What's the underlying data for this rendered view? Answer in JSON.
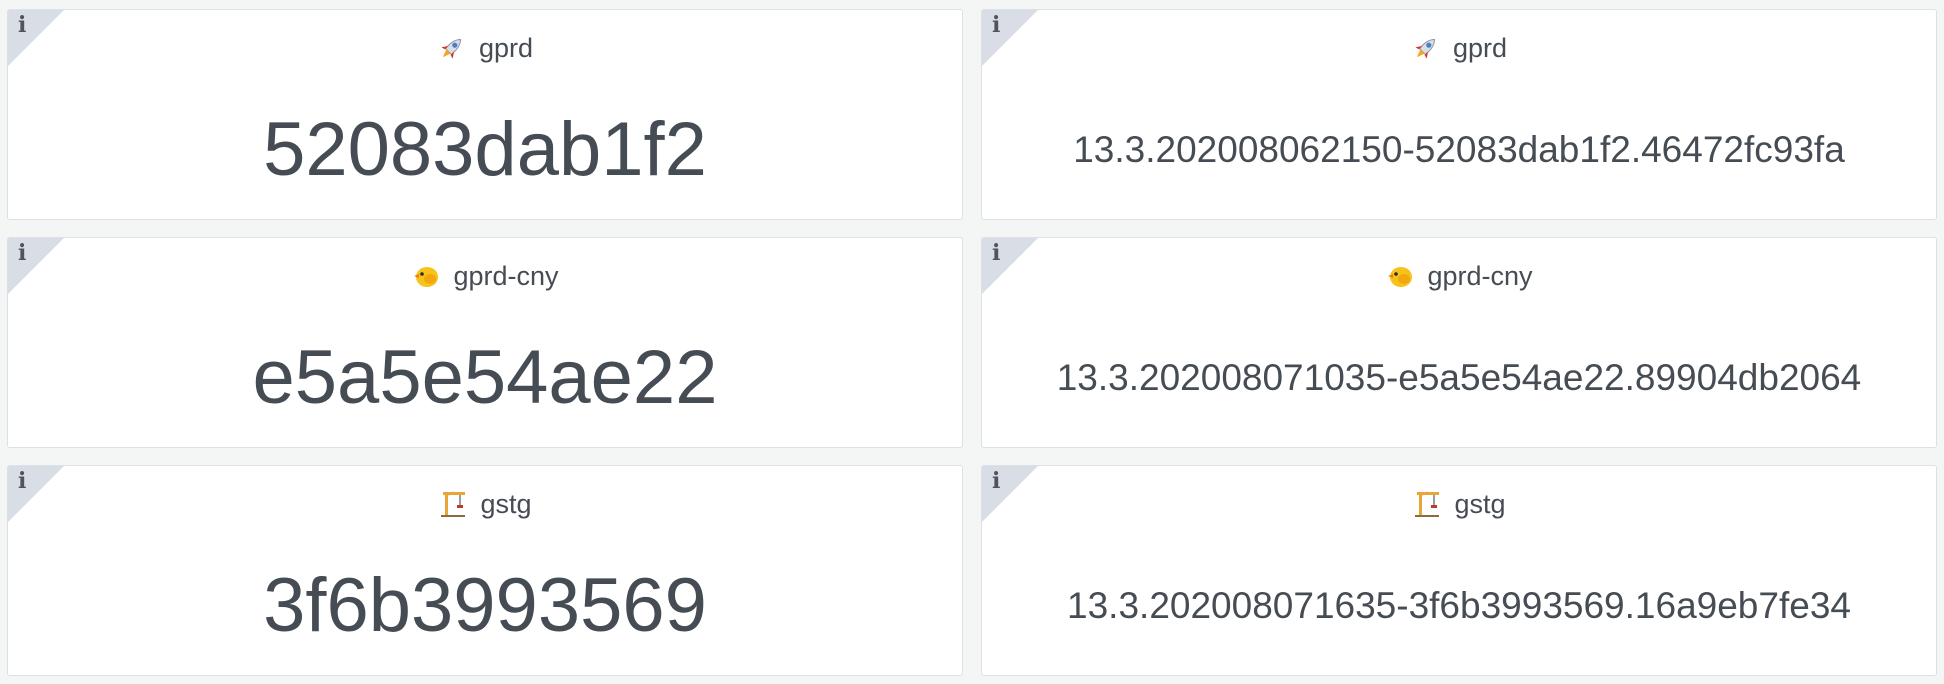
{
  "panels": [
    {
      "env": "gprd",
      "icon": "rocket-icon",
      "value": "52083dab1f2"
    },
    {
      "env": "gprd",
      "icon": "rocket-icon",
      "value": "13.3.202008062150-52083dab1f2.46472fc93fa"
    },
    {
      "env": "gprd-cny",
      "icon": "chick-icon",
      "value": "e5a5e54ae22"
    },
    {
      "env": "gprd-cny",
      "icon": "chick-icon",
      "value": "13.3.202008071035-e5a5e54ae22.89904db2064"
    },
    {
      "env": "gstg",
      "icon": "construction-crane-icon",
      "value": "3f6b3993569"
    },
    {
      "env": "gstg",
      "icon": "construction-crane-icon",
      "value": "13.3.202008071635-3f6b3993569.16a9eb7fe34"
    }
  ],
  "info_glyph": "i",
  "colors": {
    "background": "#f4f5f5",
    "panel": "#ffffff",
    "text": "#464c54",
    "corner": "#d8dde6"
  }
}
